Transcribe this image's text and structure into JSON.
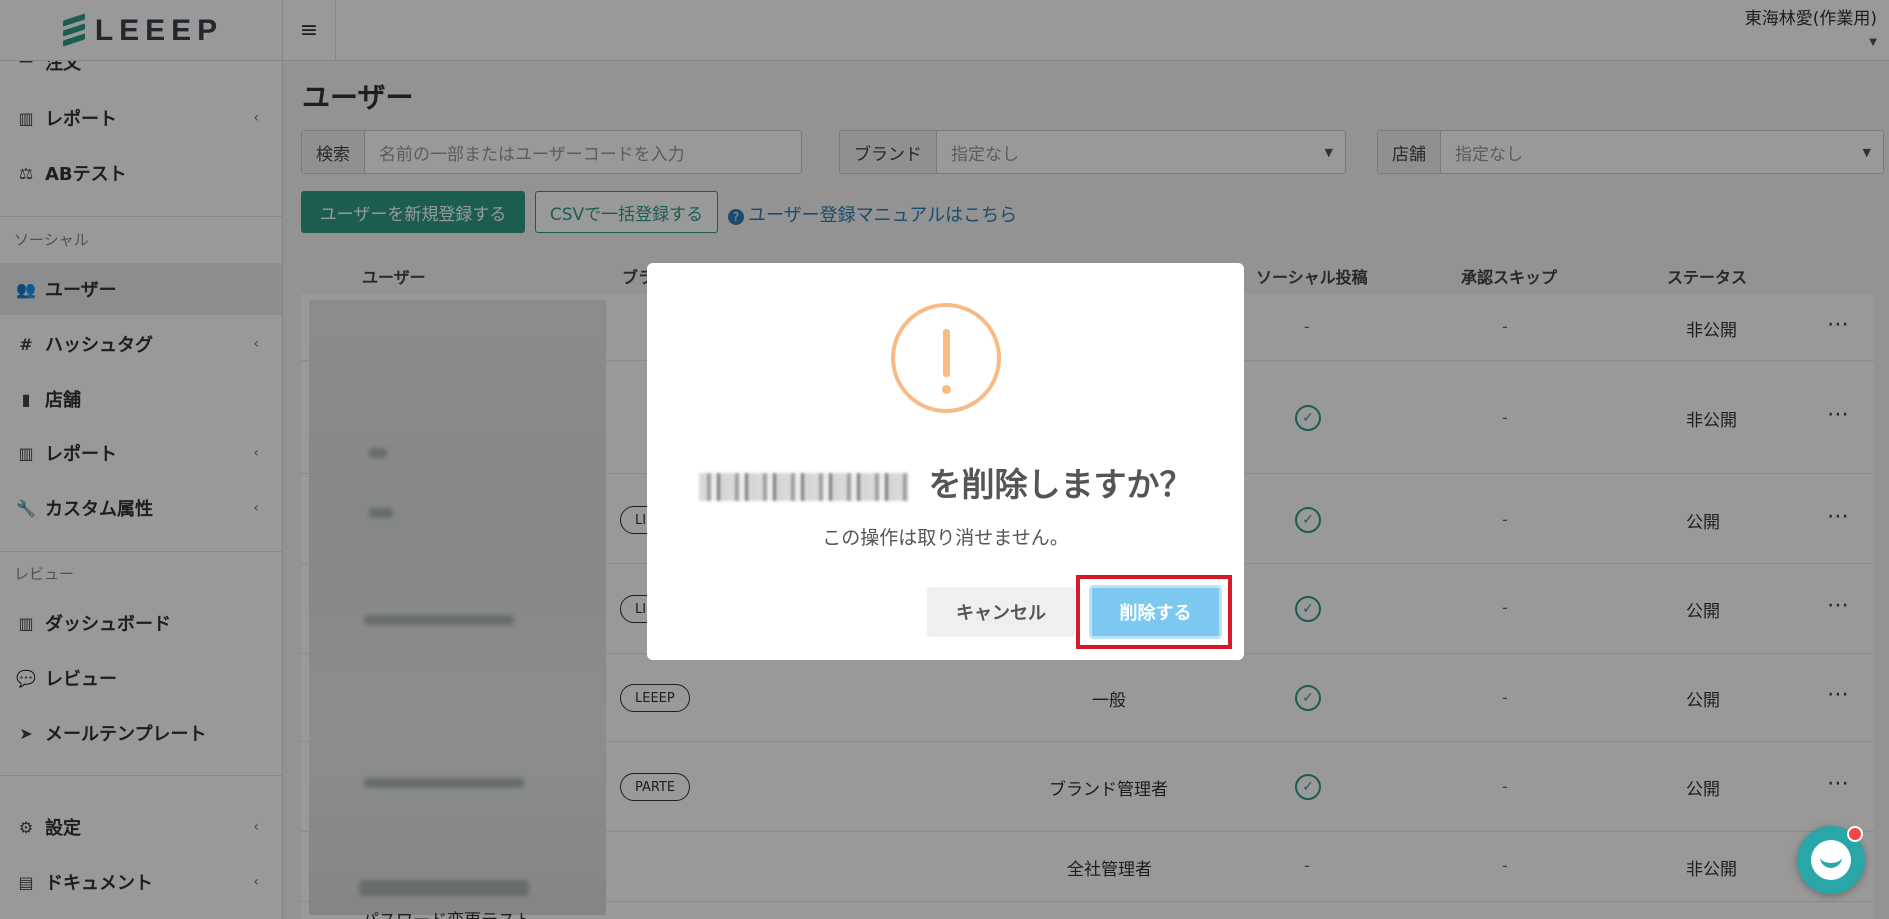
{
  "header": {
    "logo_text": "LEEEP",
    "user_name": "東海林愛(作業用)"
  },
  "sidebar": {
    "items": [
      {
        "label": "注文",
        "icon": "cart-icon"
      },
      {
        "label": "レポート",
        "icon": "chart-bar-icon"
      },
      {
        "label": "ABテスト",
        "icon": "balance-scale-icon"
      },
      {
        "label": "ユーザー",
        "icon": "users-icon"
      },
      {
        "label": "ハッシュタグ",
        "icon": "hashtag-icon"
      },
      {
        "label": "店舗",
        "icon": "building-icon"
      },
      {
        "label": "レポート",
        "icon": "chart-bar-icon"
      },
      {
        "label": "カスタム属性",
        "icon": "wrench-icon"
      },
      {
        "label": "ダッシュボード",
        "icon": "chart-bar-icon"
      },
      {
        "label": "レビュー",
        "icon": "comments-icon"
      },
      {
        "label": "メールテンプレート",
        "icon": "paper-plane-icon"
      },
      {
        "label": "設定",
        "icon": "gear-icon"
      },
      {
        "label": "ドキュメント",
        "icon": "document-icon"
      }
    ],
    "sections": {
      "social": "ソーシャル",
      "review": "レビュー"
    }
  },
  "main": {
    "title": "ユーザー",
    "filters": {
      "search_label": "検索",
      "search_placeholder": "名前の一部またはユーザーコードを入力",
      "brand_label": "ブランド",
      "brand_value": "指定なし",
      "store_label": "店舗",
      "store_value": "指定なし"
    },
    "actions": {
      "new_user": "ユーザーを新規登録する",
      "csv_import": "CSVで一括登録する",
      "manual_link": "ユーザー登録マニュアルはこちら"
    },
    "table": {
      "headers": [
        "ユーザー",
        "ブラ",
        "ソーシャル投稿",
        "承認スキップ",
        "ステータス"
      ],
      "rows": [
        {
          "brand": "",
          "role": "",
          "social": "-",
          "skip": "-",
          "status": "非公開"
        },
        {
          "brand": "",
          "role": "",
          "social": "check",
          "skip": "-",
          "status": "非公開"
        },
        {
          "brand": "LI",
          "role": "",
          "social": "check",
          "skip": "-",
          "status": "公開"
        },
        {
          "brand": "LI",
          "role": "",
          "social": "check",
          "skip": "-",
          "status": "公開"
        },
        {
          "brand": "LEEEP",
          "role": "一般",
          "social": "check",
          "skip": "-",
          "status": "公開"
        },
        {
          "brand": "PARTE",
          "role": "ブランド管理者",
          "social": "check",
          "skip": "-",
          "status": "公開"
        },
        {
          "brand": "",
          "role": "全社管理者",
          "social": "-",
          "skip": "-",
          "status": "非公開"
        }
      ],
      "bottom_partial": "パスワード変更テスト"
    }
  },
  "modal": {
    "title_suffix": "を削除しますか？",
    "subtitle": "この操作は取り消せません。",
    "cancel_label": "キャンセル",
    "delete_label": "削除する"
  },
  "colors": {
    "brand_green": "#2e9b86",
    "warning": "#f8bb86",
    "delete_button": "#7cc8f0",
    "highlight": "#d71a28"
  }
}
